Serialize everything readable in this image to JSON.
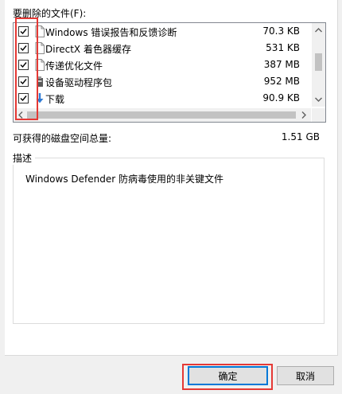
{
  "files_label": "要删除的文件(F):",
  "files": [
    {
      "name": "Windows 错误报告和反馈诊断",
      "size": "70.3 KB",
      "checked": true,
      "icon": "document-icon"
    },
    {
      "name": "DirectX 着色器缓存",
      "size": "531 KB",
      "checked": true,
      "icon": "document-icon"
    },
    {
      "name": "传递优化文件",
      "size": "387 MB",
      "checked": true,
      "icon": "document-icon"
    },
    {
      "name": "设备驱动程序包",
      "size": "952 MB",
      "checked": true,
      "icon": "device-package-icon"
    },
    {
      "name": "下载",
      "size": "90.9 KB",
      "checked": true,
      "icon": "download-arrow-icon"
    }
  ],
  "total": {
    "label": "可获得的磁盘空间总量:",
    "value": "1.51 GB"
  },
  "description": {
    "title": "描述",
    "text": "Windows Defender 防病毒使用的非关键文件"
  },
  "buttons": {
    "ok": "确定",
    "cancel": "取消"
  },
  "colors": {
    "highlight": "#e53935",
    "accent": "#0078d7",
    "download_icon": "#2f7bd4"
  }
}
